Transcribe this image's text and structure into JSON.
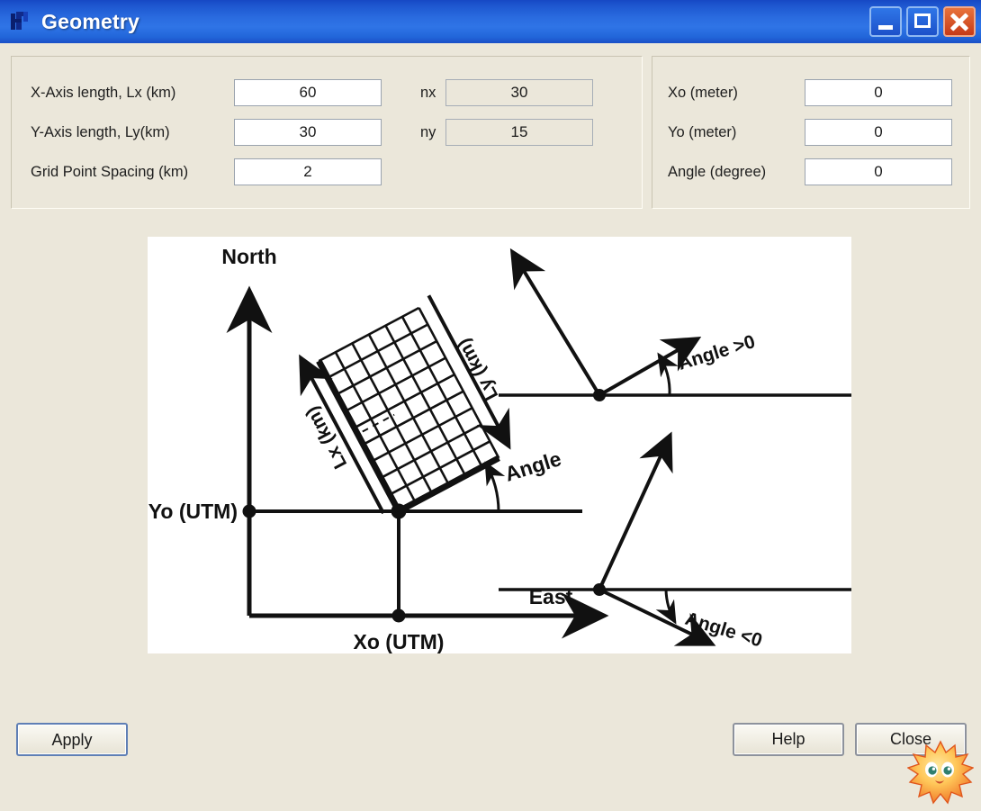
{
  "window": {
    "title": "Geometry",
    "icon": "app-icon",
    "controls": {
      "minimize": "minimize-button",
      "maximize": "maximize-button",
      "close": "close-window-button"
    },
    "titlebar_color": "#2a6ce0",
    "background_color": "#ebe7da"
  },
  "panels": {
    "left": {
      "fields": [
        {
          "label": "X-Axis length, Lx (km)",
          "value": "60",
          "readonly": false
        },
        {
          "label": "Y-Axis length, Ly(km)",
          "value": "30",
          "readonly": false
        },
        {
          "label": "Grid Point Spacing (km)",
          "value": "2",
          "readonly": false
        }
      ],
      "counts": [
        {
          "label": "nx",
          "value": "30",
          "readonly": true
        },
        {
          "label": "ny",
          "value": "15",
          "readonly": true
        }
      ]
    },
    "right": {
      "fields": [
        {
          "label": "Xo (meter)",
          "value": "0",
          "readonly": false
        },
        {
          "label": "Yo (meter)",
          "value": "0",
          "readonly": false
        },
        {
          "label": "Angle (degree)",
          "value": "0",
          "readonly": false
        }
      ]
    }
  },
  "diagram": {
    "labels": {
      "north": "North",
      "east": "East",
      "yo_utm": "Yo (UTM)",
      "xo_utm": "Xo (UTM)",
      "lx": "Lx (km)",
      "ly": "Ly (km)",
      "angle": "Angle",
      "angle_positive": "Angle >0",
      "angle_negative": "Angle <0"
    },
    "grid": {
      "columns": 6,
      "rows": 9,
      "rotation_degrees": -28
    },
    "background_color": "#ffffff",
    "ink_color": "#111111"
  },
  "buttons": {
    "apply": "Apply",
    "help": "Help",
    "close": "Close"
  },
  "cursor": {
    "icon": "sun-mascot-cursor"
  }
}
